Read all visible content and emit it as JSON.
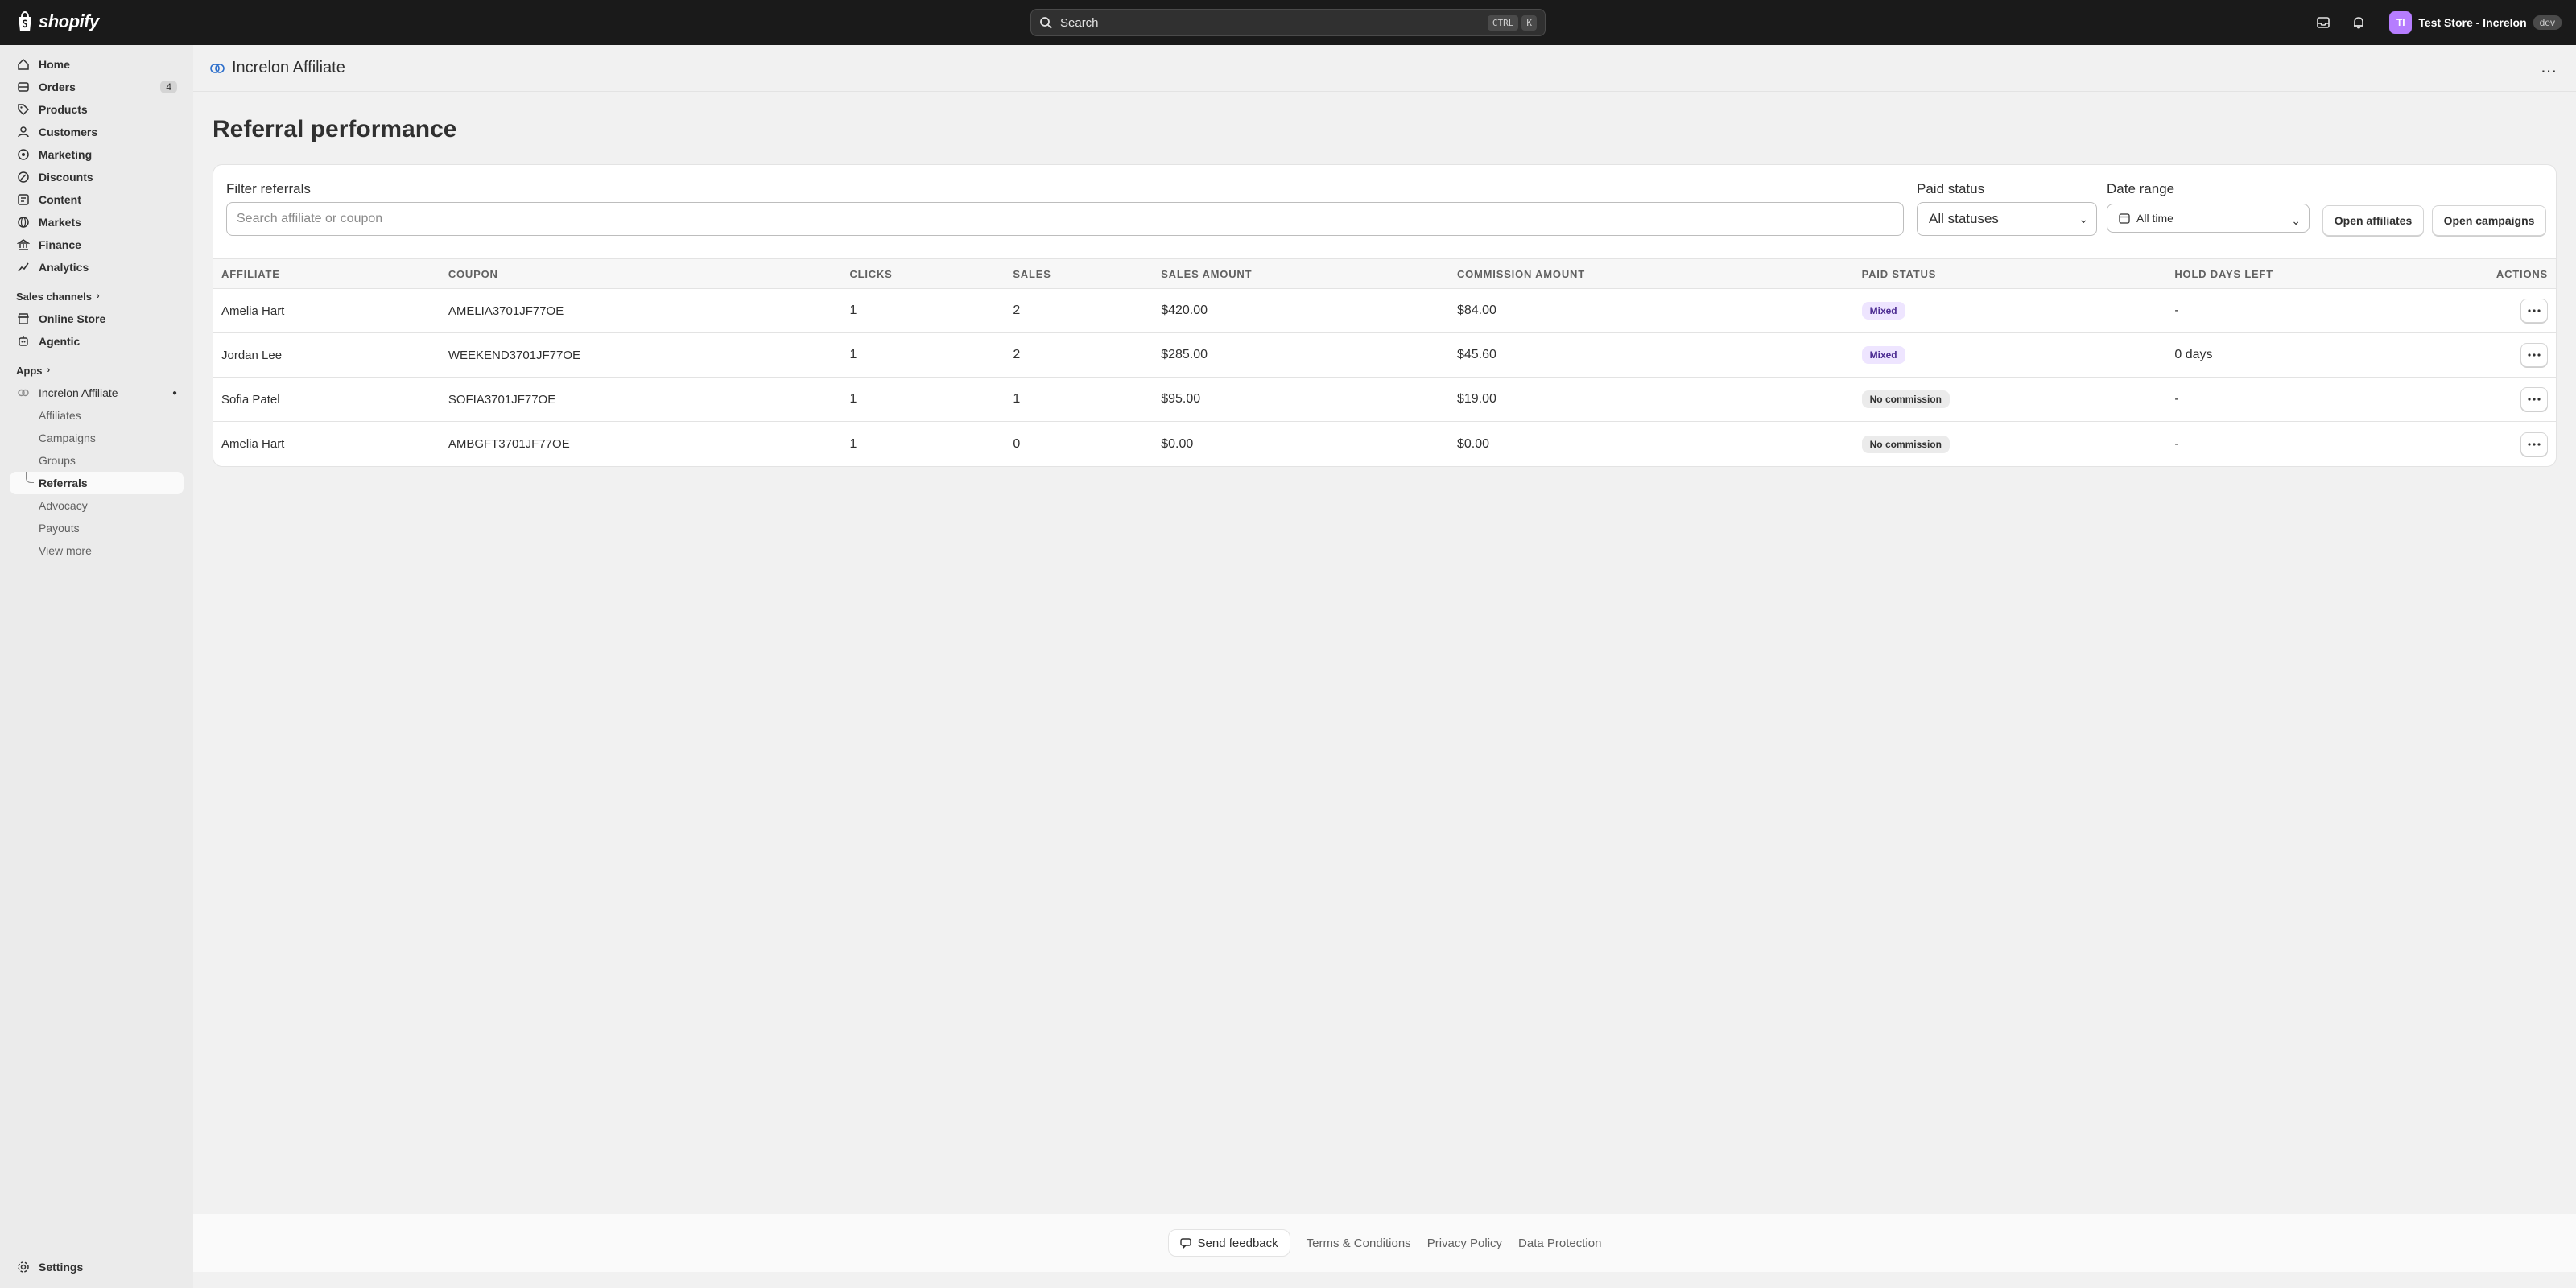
{
  "topbar": {
    "logo_text": "shopify",
    "search_placeholder": "Search",
    "kbd": [
      "CTRL",
      "K"
    ],
    "avatar_initials": "TI",
    "store_name": "Test Store - Increlon",
    "dev_badge": "dev",
    "accent": "#b67dff"
  },
  "sidebar": {
    "items": [
      {
        "label": "Home",
        "icon": "home-icon"
      },
      {
        "label": "Orders",
        "icon": "orders-icon",
        "badge": "4"
      },
      {
        "label": "Products",
        "icon": "tag-icon"
      },
      {
        "label": "Customers",
        "icon": "person-icon"
      },
      {
        "label": "Marketing",
        "icon": "target-icon"
      },
      {
        "label": "Discounts",
        "icon": "discount-icon"
      },
      {
        "label": "Content",
        "icon": "content-icon"
      },
      {
        "label": "Markets",
        "icon": "globe-icon"
      },
      {
        "label": "Finance",
        "icon": "bank-icon"
      },
      {
        "label": "Analytics",
        "icon": "chart-icon"
      }
    ],
    "sales_channels_label": "Sales channels",
    "channels": [
      {
        "label": "Online Store",
        "icon": "store-icon"
      },
      {
        "label": "Agentic",
        "icon": "agent-icon"
      }
    ],
    "apps_label": "Apps",
    "app_name": "Increlon Affiliate",
    "app_subitems": [
      "Affiliates",
      "Campaigns",
      "Groups",
      "Referrals",
      "Advocacy",
      "Payouts",
      "View more"
    ],
    "active_subitem": "Referrals",
    "settings_label": "Settings"
  },
  "header": {
    "app_title": "Increlon Affiliate",
    "more": "⋯"
  },
  "page": {
    "title": "Referral performance"
  },
  "filters": {
    "filter_label": "Filter referrals",
    "search_placeholder": "Search affiliate or coupon",
    "paid_status_label": "Paid status",
    "paid_status_value": "All statuses",
    "date_range_label": "Date range",
    "date_range_value": "All time",
    "open_affiliates": "Open affiliates",
    "open_campaigns": "Open campaigns"
  },
  "table": {
    "headers": [
      "AFFILIATE",
      "COUPON",
      "CLICKS",
      "SALES",
      "SALES AMOUNT",
      "COMMISSION AMOUNT",
      "PAID STATUS",
      "HOLD DAYS LEFT",
      "ACTIONS"
    ],
    "rows": [
      {
        "affiliate": "Amelia Hart",
        "coupon": "AMELIA3701JF77OE",
        "clicks": "1",
        "sales": "2",
        "sales_amount": "$420.00",
        "commission": "$84.00",
        "paid_status": "Mixed",
        "hold": "-"
      },
      {
        "affiliate": "Jordan Lee",
        "coupon": "WEEKEND3701JF77OE",
        "clicks": "1",
        "sales": "2",
        "sales_amount": "$285.00",
        "commission": "$45.60",
        "paid_status": "Mixed",
        "hold": "0 days"
      },
      {
        "affiliate": "Sofia Patel",
        "coupon": "SOFIA3701JF77OE",
        "clicks": "1",
        "sales": "1",
        "sales_amount": "$95.00",
        "commission": "$19.00",
        "paid_status": "No commission",
        "hold": "-"
      },
      {
        "affiliate": "Amelia Hart",
        "coupon": "AMBGFT3701JF77OE",
        "clicks": "1",
        "sales": "0",
        "sales_amount": "$0.00",
        "commission": "$0.00",
        "paid_status": "No commission",
        "hold": "-"
      }
    ]
  },
  "footer": {
    "send_feedback": "Send feedback",
    "terms": "Terms & Conditions",
    "privacy": "Privacy Policy",
    "data_protection": "Data Protection"
  }
}
